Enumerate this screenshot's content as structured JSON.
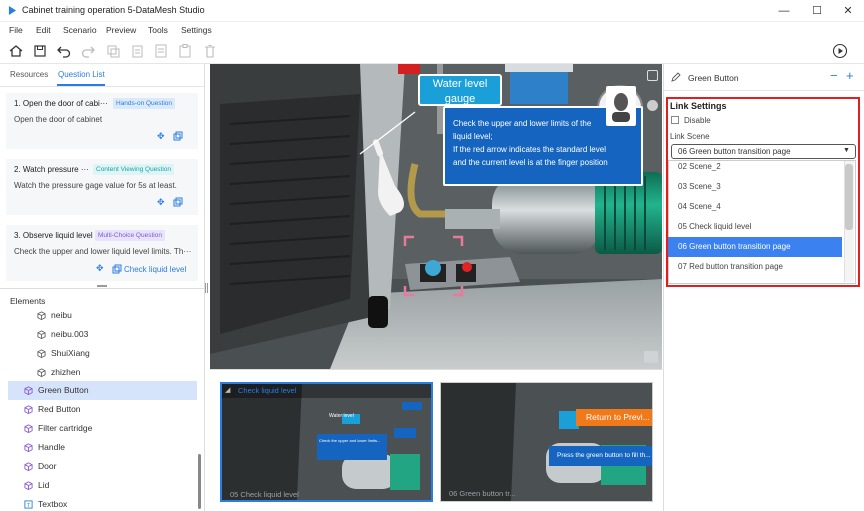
{
  "window": {
    "title": "Cabinet training operation 5-DataMesh Studio",
    "minimize": "—",
    "maximize": "☐",
    "close": "✕"
  },
  "menu": [
    "File",
    "Edit",
    "Scenario",
    "Preview",
    "Tools",
    "Settings"
  ],
  "left_tabs": {
    "resources": "Resources",
    "question_list": "Question List"
  },
  "questions": [
    {
      "title": "1. Open the door of cabi···",
      "tag": "Hands-on Question",
      "desc": "Open the door of cabinet",
      "link": ""
    },
    {
      "title": "2. Watch pressure ···",
      "tag": "Content Viewing Question",
      "desc": "Watch the pressure gage value for 5s at least.",
      "link": ""
    },
    {
      "title": "3. Observe liquid level",
      "tag": "Multi-Choice Question",
      "desc": "Check the upper and lower liquid level limits. Th···",
      "link": "Check liquid level"
    }
  ],
  "elements": {
    "header": "Elements",
    "items": [
      {
        "label": "neibu",
        "icon": "cube-outline-icon"
      },
      {
        "label": "neibu.003",
        "icon": "cube-outline-icon"
      },
      {
        "label": "ShuiXiang",
        "icon": "cube-outline-icon"
      },
      {
        "label": "zhizhen",
        "icon": "cube-outline-icon"
      },
      {
        "label": "Green Button",
        "icon": "cube-purple-icon"
      },
      {
        "label": "Red Button",
        "icon": "cube-purple-icon"
      },
      {
        "label": "Filter cartridge",
        "icon": "cube-purple-icon"
      },
      {
        "label": "Handle",
        "icon": "cube-purple-icon"
      },
      {
        "label": "Door",
        "icon": "cube-purple-icon"
      },
      {
        "label": "Lid",
        "icon": "cube-purple-icon"
      },
      {
        "label": "Textbox",
        "icon": "textbox-icon"
      }
    ]
  },
  "viewport": {
    "water_label_line1": "Water level",
    "water_label_line2": "gauge",
    "callout_lines": [
      "Check the upper and lower limits of the",
      "liquid level;",
      "If the red arrow indicates the standard level",
      "and the current level is at the finger position"
    ]
  },
  "thumbnails": [
    {
      "header": "Check liquid level",
      "footer": "05  Check liquid level",
      "selected": true,
      "inner_tag": "Water level",
      "inner_text": "Check the upper and lower limits..."
    },
    {
      "header": "",
      "footer": "06  Green button tr...",
      "selected": false,
      "banner": "Return to Previ...",
      "caption": "Press the green button to fill th..."
    }
  ],
  "right_panel": {
    "element_name": "Green Button",
    "section_title": "Link Settings",
    "disable_label": "Disable",
    "link_scene_label": "Link Scene",
    "selected_scene": "06  Green button transition page",
    "options": [
      {
        "label": "02  Scene_2",
        "selected": false
      },
      {
        "label": "03  Scene_3",
        "selected": false
      },
      {
        "label": "04  Scene_4",
        "selected": false
      },
      {
        "label": "05  Check liquid level",
        "selected": false
      },
      {
        "label": "06  Green button transition page",
        "selected": true
      },
      {
        "label": "07  Red button transition page",
        "selected": false
      }
    ]
  },
  "colors": {
    "accent": "#2a7de1",
    "selected_row": "#3b82f0",
    "highlight_red": "#e02020",
    "water_label": "#1a9fd9",
    "callout": "#1565c0"
  }
}
